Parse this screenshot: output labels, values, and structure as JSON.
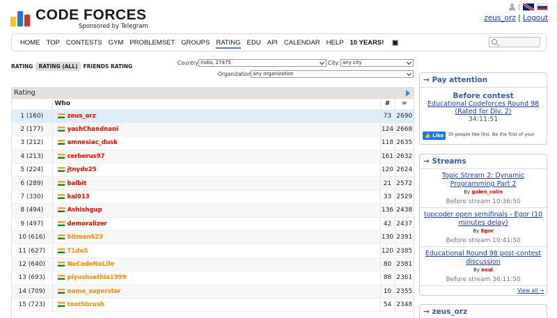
{
  "brand": {
    "name_part1": "CODE",
    "name_part2": "FORCES",
    "sponsor": "Sponsored by Telegram",
    "bar_colors": [
      "#f5c518",
      "#1a7ad9",
      "#d9312d"
    ]
  },
  "user": {
    "handle": "zeus_orz",
    "separator": "|",
    "logout": "Logout"
  },
  "menu": {
    "items": [
      "HOME",
      "TOP",
      "CONTESTS",
      "GYM",
      "PROBLEMSET",
      "GROUPS",
      "RATING",
      "EDU",
      "API",
      "CALENDAR",
      "HELP"
    ],
    "active": "RATING",
    "years": "10 YEARS!"
  },
  "filters": {
    "tabs": [
      "RATING",
      "RATING (ALL)",
      "FRIENDS RATING"
    ],
    "active_tab": "RATING (ALL)",
    "country_label": "Country:",
    "country_value": "India, 27475",
    "city_label": "City:",
    "city_value": "any city",
    "org_label": "Organization:",
    "org_value": "any organization"
  },
  "rating": {
    "title": "Rating",
    "headers": {
      "who": "Who",
      "num": "#",
      "eq": "="
    },
    "rows": [
      {
        "rank": "1 (160)",
        "handle": "zeus_orz",
        "color": "red",
        "count": "73",
        "rating": "2690"
      },
      {
        "rank": "2 (177)",
        "handle": "yashChandnani",
        "color": "red",
        "count": "124",
        "rating": "2668"
      },
      {
        "rank": "3 (212)",
        "handle": "amnesiac_dusk",
        "color": "red",
        "count": "118",
        "rating": "2635"
      },
      {
        "rank": "4 (213)",
        "handle": "cerberus97",
        "color": "red",
        "count": "161",
        "rating": "2632"
      },
      {
        "rank": "5 (224)",
        "handle": "jtnydv25",
        "color": "red",
        "count": "120",
        "rating": "2624"
      },
      {
        "rank": "6 (289)",
        "handle": "balbit",
        "color": "red",
        "count": "21",
        "rating": "2572"
      },
      {
        "rank": "7 (330)",
        "handle": "kal013",
        "color": "red",
        "count": "33",
        "rating": "2529"
      },
      {
        "rank": "8 (494)",
        "handle": "Ashishgup",
        "color": "red",
        "count": "136",
        "rating": "2438"
      },
      {
        "rank": "9 (497)",
        "handle": "demoralizer",
        "color": "red",
        "count": "42",
        "rating": "2437"
      },
      {
        "rank": "10 (616)",
        "handle": "hitman623",
        "color": "orange",
        "count": "130",
        "rating": "2391"
      },
      {
        "rank": "11 (627)",
        "handle": "T1duS",
        "color": "orange",
        "count": "120",
        "rating": "2385"
      },
      {
        "rank": "12 (640)",
        "handle": "NoCodeNoLife",
        "color": "orange",
        "count": "80",
        "rating": "2381"
      },
      {
        "rank": "13 (693)",
        "handle": "piyushsethia1999",
        "color": "orange",
        "count": "88",
        "rating": "2361"
      },
      {
        "rank": "14 (709)",
        "handle": "namo_superstar",
        "color": "orange",
        "count": "10",
        "rating": "2355"
      },
      {
        "rank": "15 (723)",
        "handle": "toothbrush",
        "color": "orange",
        "count": "54",
        "rating": "2348"
      }
    ]
  },
  "attention": {
    "title": "→ Pay attention",
    "heading": "Before contest",
    "contest": "Educational Codeforces Round 98 (Rated for Div. 2)",
    "timer": "34:11:51",
    "like_button": "Like",
    "like_text": "30 people like this. Be the first of your friends."
  },
  "streams": {
    "title": "→ Streams",
    "items": [
      {
        "name": "Topic Stream 2: Dynamic Programming Part 2",
        "by_label": "By",
        "author": "galen_colin",
        "when": "Before stream 10:36:50"
      },
      {
        "name": "topcoder open semifinals - Egor (10 minutes delay)",
        "by_label": "By",
        "author": "Egor",
        "when": "Before stream 10:41:50"
      },
      {
        "name": "Educational Round 98 post-contest discussion",
        "by_label": "By",
        "author": "neal",
        "when": "Before stream 36:11:50"
      }
    ],
    "view_all": "View all →"
  },
  "user_box": {
    "title": "→ zeus_orz"
  }
}
